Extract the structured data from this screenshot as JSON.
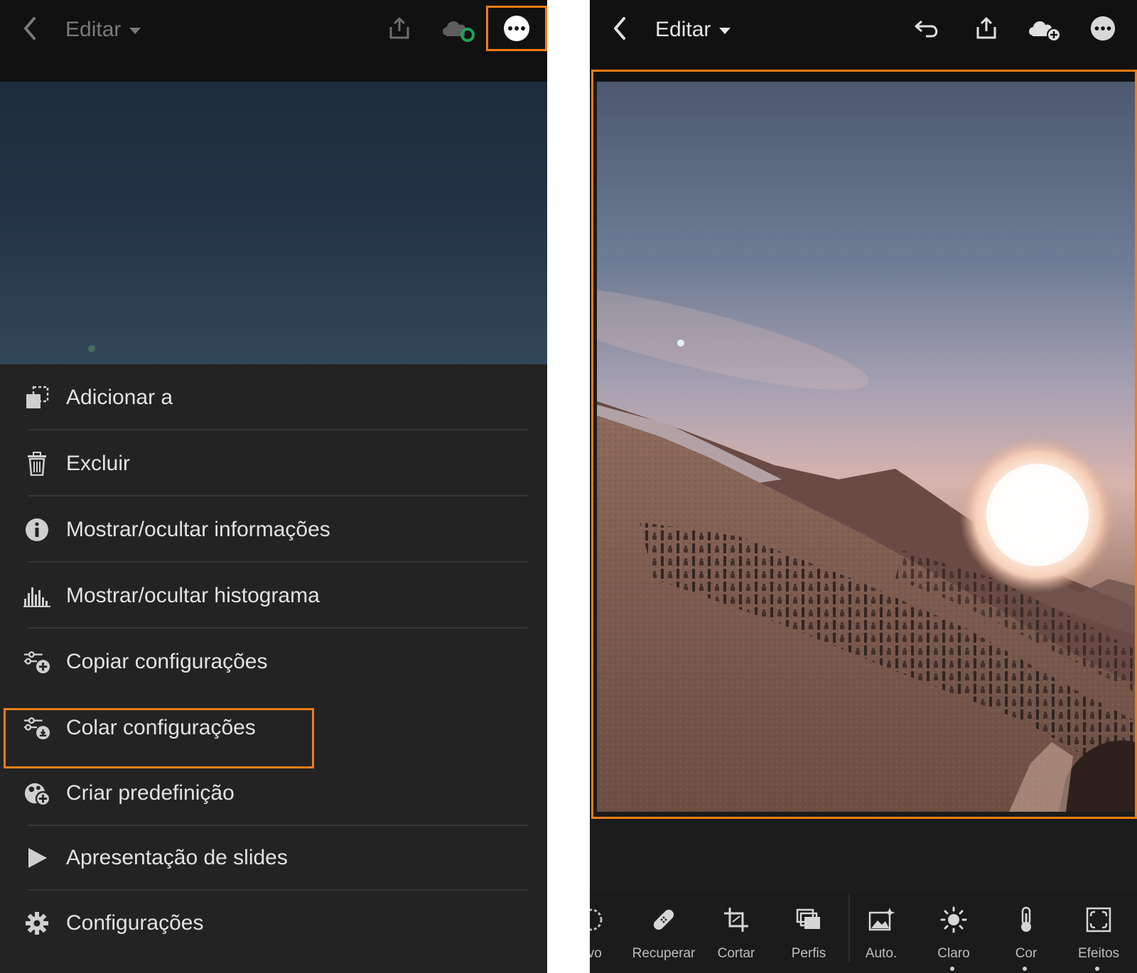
{
  "left_screen": {
    "header": {
      "title": "Editar",
      "icons": [
        "back-chevron-icon",
        "share-icon",
        "cloud-sync-icon",
        "more-options-icon"
      ]
    },
    "menu": {
      "items": [
        {
          "label": "Adicionar a",
          "icon": "add-to-album-icon"
        },
        {
          "label": "Excluir",
          "icon": "trash-icon"
        },
        {
          "label": "Mostrar/ocultar informações",
          "icon": "info-icon"
        },
        {
          "label": "Mostrar/ocultar histograma",
          "icon": "histogram-icon"
        },
        {
          "label": "Copiar configurações",
          "icon": "copy-settings-icon"
        },
        {
          "label": "Colar configurações",
          "icon": "paste-settings-icon",
          "highlighted": true
        },
        {
          "label": "Criar predefinição",
          "icon": "create-preset-icon"
        },
        {
          "label": "Apresentação de slides",
          "icon": "play-icon"
        },
        {
          "label": "Configurações",
          "icon": "gear-icon"
        }
      ]
    }
  },
  "right_screen": {
    "header": {
      "title": "Editar",
      "icons": [
        "back-chevron-icon",
        "undo-icon",
        "share-icon",
        "cloud-add-icon",
        "more-options-icon"
      ]
    },
    "toolbar": {
      "tools": [
        {
          "label": "tivo",
          "icon": "selective-icon"
        },
        {
          "label": "Recuperar",
          "icon": "healing-icon"
        },
        {
          "label": "Cortar",
          "icon": "crop-icon"
        },
        {
          "label": "Perfis",
          "icon": "profiles-icon"
        },
        {
          "label": "Auto.",
          "icon": "auto-icon"
        },
        {
          "label": "Claro",
          "icon": "light-icon"
        },
        {
          "label": "Cor",
          "icon": "color-temperature-icon"
        },
        {
          "label": "Efeitos",
          "icon": "effects-icon"
        }
      ]
    }
  },
  "colors": {
    "highlight": "#f07d16",
    "cloud_synced": "#1fa35a",
    "menu_bg": "#232323",
    "topbar_bg": "#111111"
  }
}
